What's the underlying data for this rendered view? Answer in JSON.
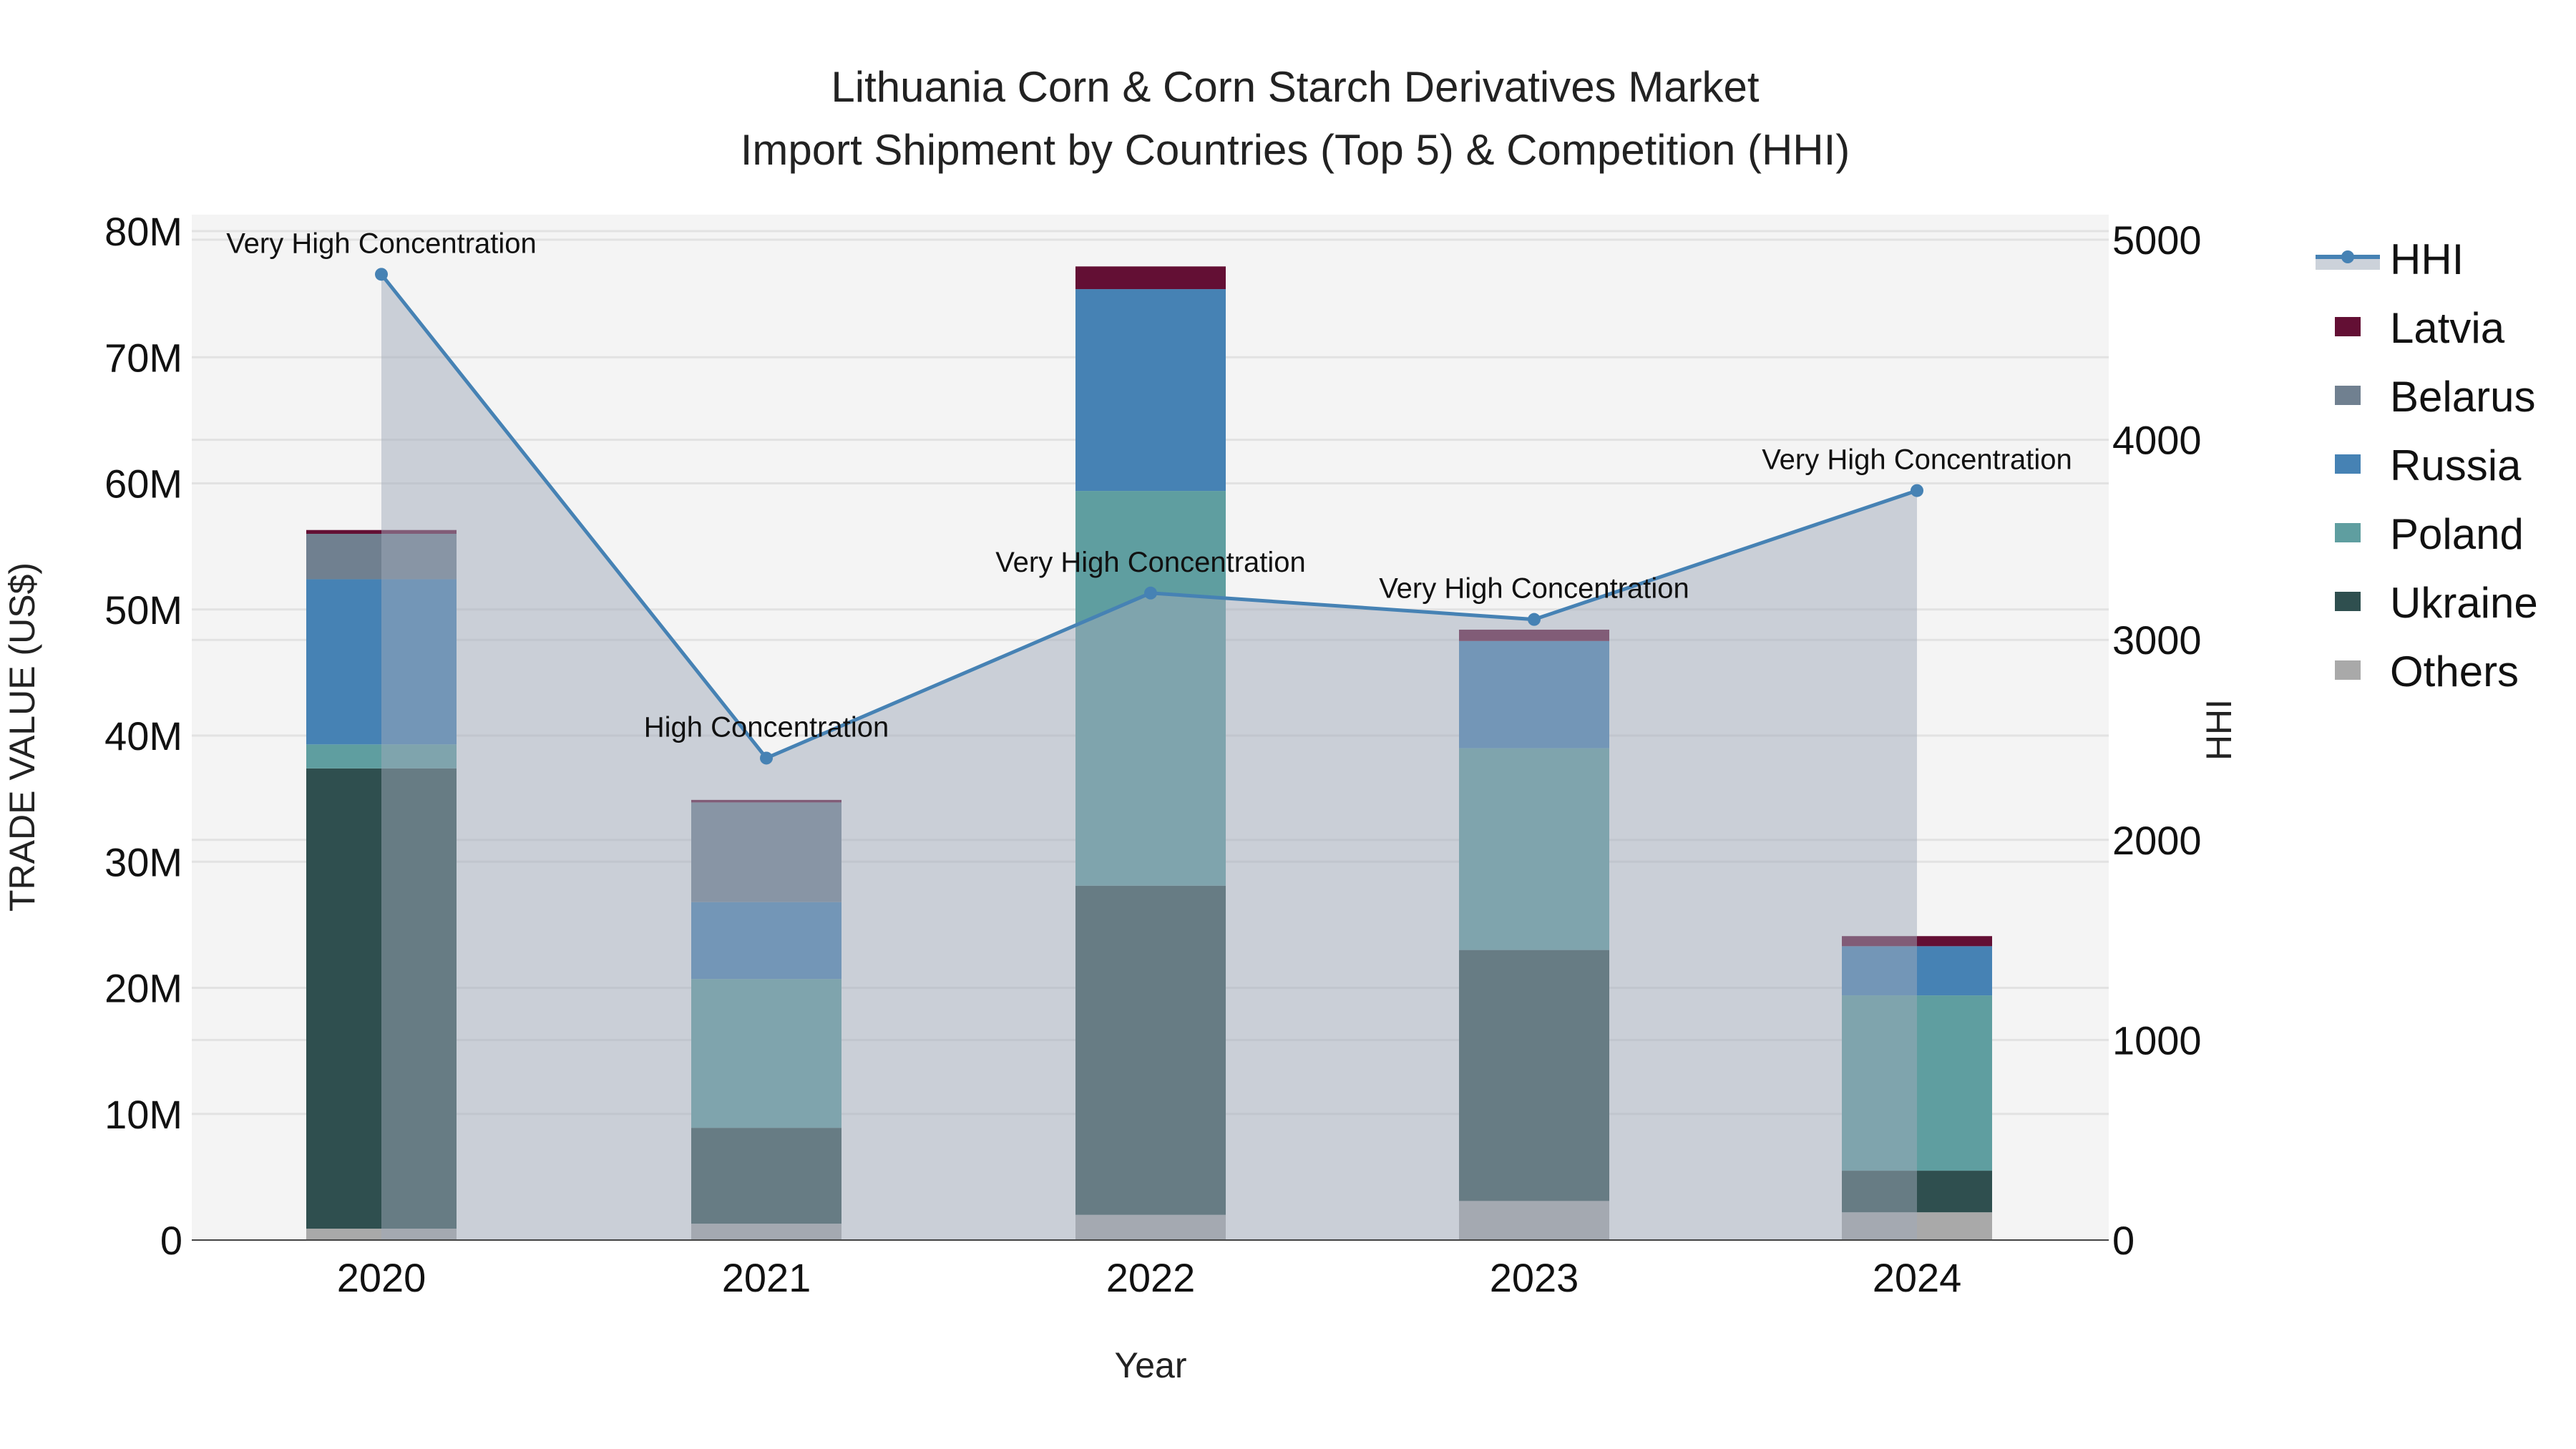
{
  "chart_data": {
    "type": "bar",
    "title": "Lithuania Corn & Corn Starch Derivatives Market",
    "subtitle": "Import Shipment by Countries (Top 5) & Competition (HHI)",
    "xlabel": "Year",
    "ylabel": "TRADE VALUE (US$)",
    "y2label": "HHI",
    "ylim": [
      0,
      80000000
    ],
    "y2lim": [
      0,
      5000
    ],
    "yticks": [
      "0",
      "10M",
      "20M",
      "30M",
      "40M",
      "50M",
      "60M",
      "70M",
      "80M"
    ],
    "y2ticks": [
      "0",
      "1000",
      "2000",
      "3000",
      "4000",
      "5000"
    ],
    "categories": [
      "2020",
      "2021",
      "2022",
      "2023",
      "2024"
    ],
    "series": [
      {
        "name": "Others",
        "color": "#a9a9a9",
        "values": [
          0.9,
          1.3,
          2.0,
          3.1,
          2.2
        ]
      },
      {
        "name": "Ukraine",
        "color": "#2f4f4f",
        "values": [
          36.5,
          7.6,
          26.1,
          19.9,
          3.3
        ]
      },
      {
        "name": "Poland",
        "color": "#5f9ea0",
        "values": [
          1.9,
          11.8,
          31.3,
          16.0,
          13.9
        ]
      },
      {
        "name": "Russia",
        "color": "#4682b4",
        "values": [
          13.1,
          6.1,
          16.0,
          8.5,
          3.9
        ]
      },
      {
        "name": "Belarus",
        "color": "#708090",
        "values": [
          3.6,
          7.9,
          0.0,
          0.0,
          0.0
        ]
      },
      {
        "name": "Latvia",
        "color": "#630f34",
        "values": [
          0.3,
          0.2,
          1.8,
          0.9,
          0.8
        ]
      }
    ],
    "value_unit": "M US$",
    "hhi": {
      "name": "HHI",
      "color": "#4682b4",
      "fill": "rgba(160,170,185,0.5)",
      "values": [
        4827,
        2409,
        3234,
        3102,
        3746
      ],
      "labels": [
        "Very High Concentration",
        "High Concentration",
        "Very High Concentration",
        "Very High Concentration",
        "Very High Concentration"
      ]
    },
    "legend": [
      "HHI",
      "Latvia",
      "Belarus",
      "Russia",
      "Poland",
      "Ukraine",
      "Others"
    ],
    "legend_placement": "right",
    "grid": true
  }
}
